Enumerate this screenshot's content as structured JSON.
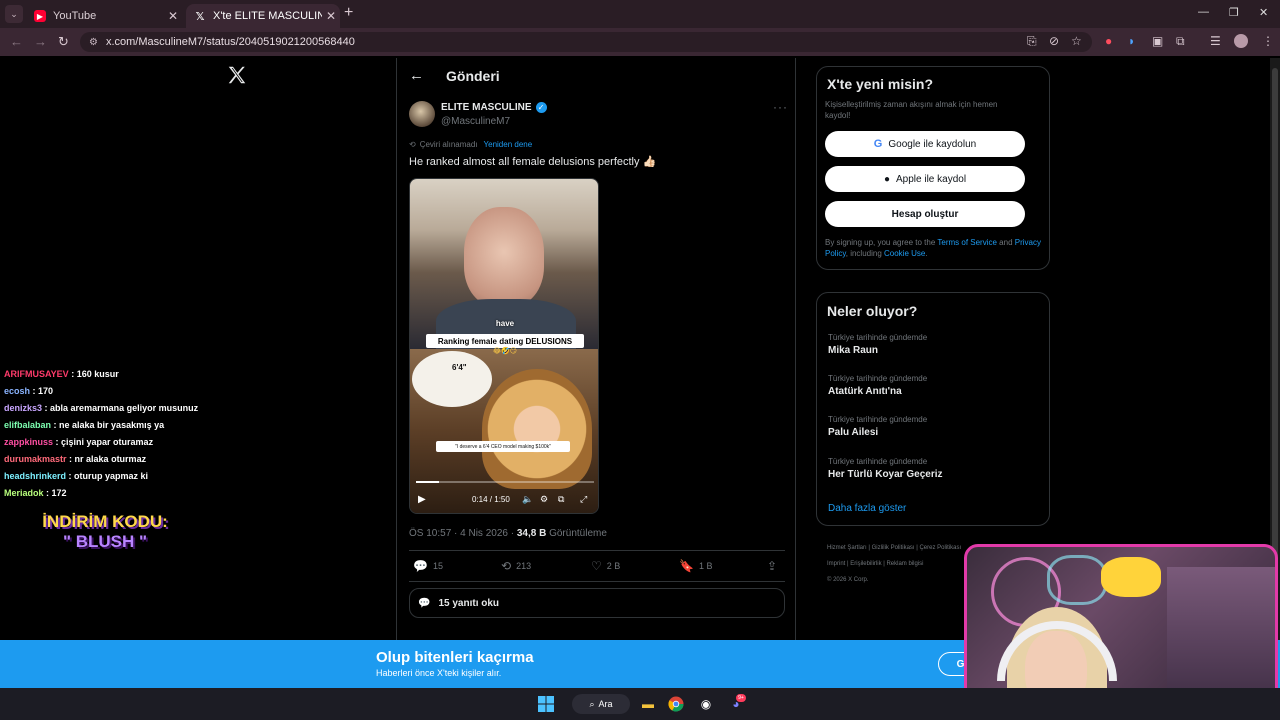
{
  "browser": {
    "tabs": [
      {
        "title": "YouTube",
        "icon": "youtube-icon"
      },
      {
        "title": "X'te ELITE MASCULINE: \"He ran",
        "icon": "x-icon",
        "active": true
      }
    ],
    "url": "x.com/MasculineM7/status/2040519021200568440",
    "window_controls": [
      "minimize",
      "restore",
      "close"
    ]
  },
  "chat": {
    "messages": [
      {
        "user": "ARIFMUSAYEV",
        "text": ": 160 kusur"
      },
      {
        "user": "ecosh",
        "text": ": 170"
      },
      {
        "user": "denizks3",
        "text": ": abla aremarmana geliyor musunuz"
      },
      {
        "user": "elifbalaban",
        "text": ": ne alaka bir yasakmış ya"
      },
      {
        "user": "zappkinuss",
        "text": ": çişini yapar oturamaz"
      },
      {
        "user": "durumakmastr",
        "text": ": nr alaka oturmaz"
      },
      {
        "user": "headshrinkerd",
        "text": ": oturup yapmaz ki"
      },
      {
        "user": "Meriadok",
        "text": ": 172"
      }
    ],
    "promo_line1": "İNDİRİM KODU:",
    "promo_line2": "\" BLUSH \""
  },
  "post": {
    "header_title": "Gönderi",
    "author_name": "ELITE MASCULINE",
    "author_handle": "@MasculineM7",
    "translate_failed": "Çeviri alınamadı",
    "translate_retry": "Yeniden dene",
    "text": "He ranked almost all female delusions perfectly 👍🏻",
    "video": {
      "overlay_word": "have",
      "caption": "Ranking female dating DELUSIONS",
      "emoji_line": "😂🤣😏",
      "bubble_text": "6'4\"",
      "quote": "\"I deserve a 6'4 CEO model making $100k\"",
      "time": "0:14 / 1:50",
      "progress": 0.13
    },
    "timestamp": "ÖS 10:57 · 4 Nis 2026 · ",
    "views_count": "34,8 B",
    "views_label": " Görüntüleme",
    "actions": {
      "replies": "15",
      "reposts": "213",
      "likes": "2 B",
      "bookmarks": "1 B"
    },
    "read_replies": "15 yanıtı oku"
  },
  "signup": {
    "title": "X'te yeni misin?",
    "subtitle": "Kişiselleştirilmiş zaman akışını almak için hemen kaydol!",
    "google_button": "Google ile kaydolun",
    "apple_button": "Apple ile kaydol",
    "create_button": "Hesap oluştur",
    "legal_prefix": "By signing up, you agree to the ",
    "terms": "Terms of Service",
    "legal_and": " and ",
    "privacy": "Privacy Policy",
    "legal_including": ", including ",
    "cookie": "Cookie Use",
    "legal_end": "."
  },
  "trends": {
    "title": "Neler oluyor?",
    "items": [
      {
        "context": "Türkiye tarihinde gündemde",
        "name": "Mika Raun"
      },
      {
        "context": "Türkiye tarihinde gündemde",
        "name": "Atatürk Anıtı'na"
      },
      {
        "context": "Türkiye tarihinde gündemde",
        "name": "Palu Ailesi"
      },
      {
        "context": "Türkiye tarihinde gündemde",
        "name": "Her Türlü Koyar Geçeriz"
      }
    ],
    "show_more": "Daha fazla göster"
  },
  "footer": {
    "line1": "Hizmet Şartları  |  Gizlilik Politikası  |  Çerez Politikası",
    "line2": "Imprint  |  Erişilebilirlik  |  Reklam bilgisi",
    "line3": "© 2026 X Corp."
  },
  "banner": {
    "title": "Olup bitenleri kaçırma",
    "subtitle": "Haberleri önce X'teki kişiler alır.",
    "login": "Giriş"
  },
  "taskbar": {
    "search": "Ara",
    "discord_badge": "9+"
  },
  "colors": {
    "x_blue": "#1d9bf0",
    "browser_frame": "#3a2733",
    "webcam_border": "#e23aa9"
  }
}
